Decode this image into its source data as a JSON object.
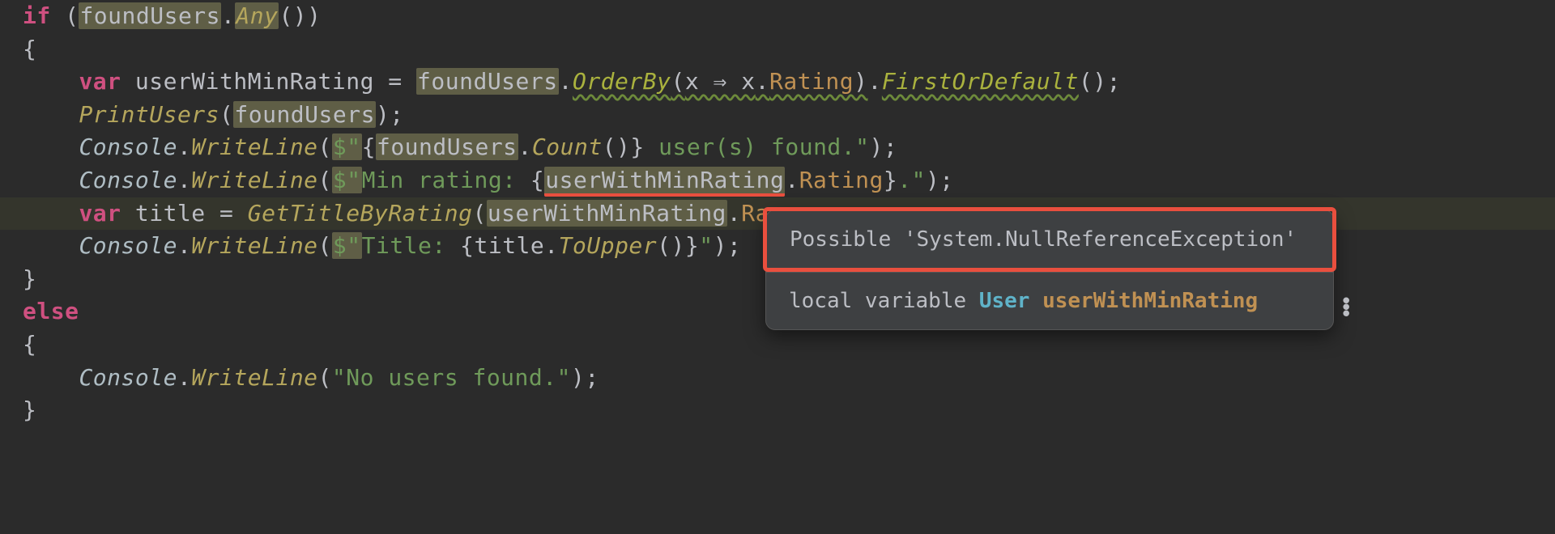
{
  "code": {
    "line1_if": "if",
    "line1_open": " (",
    "line1_var": "foundUsers",
    "line1_dot": ".",
    "line1_any": "Any",
    "line1_close": "())",
    "line2_brace": "{",
    "line3_var_kw": "var",
    "line3_sp": " ",
    "line3_name": "userWithMinRating",
    "line3_eq": " = ",
    "line3_src": "foundUsers",
    "line3_dot1": ".",
    "line3_orderby": "OrderBy",
    "line3_lam_open": "(",
    "line3_lam": "x ⇒ x",
    "line3_dot2": ".",
    "line3_rating": "Rating",
    "line3_lam_close": ")",
    "line3_dot3": ".",
    "line3_fod": "FirstOrDefault",
    "line3_end": "();",
    "line4_call": "PrintUsers",
    "line4_open": "(",
    "line4_arg": "foundUsers",
    "line4_close": ");",
    "line5_console": "Console",
    "line5_dot": ".",
    "line5_wl": "WriteLine",
    "line5_open": "(",
    "line5_d": "$\"",
    "line5_ob": "{",
    "line5_fu": "foundUsers",
    "line5_dot2": ".",
    "line5_count": "Count",
    "line5_p": "()",
    "line5_cb": "}",
    "line5_str": " user(s) found.",
    "line5_q": "\"",
    "line5_end": ");",
    "line6_console": "Console",
    "line6_dot": ".",
    "line6_wl": "WriteLine",
    "line6_open": "(",
    "line6_d": "$\"",
    "line6_str1": "Min rating: ",
    "line6_ob": "{",
    "line6_uw": "userWithMinRating",
    "line6_dot2": ".",
    "line6_rating": "Rating",
    "line6_cb": "}",
    "line6_str2": ".",
    "line6_q": "\"",
    "line6_end": ");",
    "line7_varkw": "var",
    "line7_sp": " ",
    "line7_title": "title",
    "line7_eq": " = ",
    "line7_call": "GetTitleByRating",
    "line7_open": "(",
    "line7_uw": "userWithMinRating",
    "line7_dot": ".",
    "line7_ra": "Ra",
    "line8_console": "Console",
    "line8_dot": ".",
    "line8_wl": "WriteLine",
    "line8_open": "(",
    "line8_d": "$\"",
    "line8_str1": "Title: ",
    "line8_ob": "{",
    "line8_title": "title",
    "line8_dot2": ".",
    "line8_tu": "ToUpper",
    "line8_p": "()",
    "line8_cb": "}",
    "line8_q": "\"",
    "line8_end": ");",
    "line9_brace": "}",
    "line10_else": "else",
    "line11_brace": "{",
    "line12_console": "Console",
    "line12_dot": ".",
    "line12_wl": "WriteLine",
    "line12_open": "(",
    "line12_str": "\"No users found.\"",
    "line12_end": ");",
    "line13_brace": "}"
  },
  "tooltip": {
    "warning": "Possible 'System.NullReferenceException'",
    "info_prefix": "local variable ",
    "info_type": "User",
    "info_space": " ",
    "info_name": "userWithMinRating"
  }
}
